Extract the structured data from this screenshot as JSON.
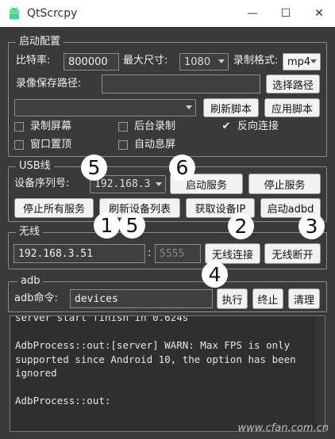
{
  "window": {
    "title": "QtScrcpy",
    "minimize": "—",
    "maximize": "☐",
    "close": "✕"
  },
  "startup": {
    "title": "启动配置",
    "bitrate_label": "比特率:",
    "bitrate_value": "800000",
    "maxsize_label": "最大尺寸:",
    "maxsize_value": "1080",
    "format_label": "录制格式:",
    "format_value": "mp4",
    "savepath_label": "录像保存路径:",
    "savepath_value": "",
    "select_path_button": "选择路径",
    "script_value": "",
    "refresh_script_button": "刷新脚本",
    "apply_script_button": "应用脚本",
    "record_screen": "录制屏幕",
    "background_record": "后台录制",
    "reverse_connect": "反向连接",
    "window_top": "窗口置顶",
    "auto_lock": "自动息屏",
    "check_mark": "✔"
  },
  "usb": {
    "title": "USB线",
    "serial_label": "设备序列号:",
    "serial_value": "192.168.3",
    "start_service_button": "启动服务",
    "stop_service_button": "停止服务",
    "stop_all_button": "停止所有服务",
    "refresh_devices_button": "刷新设备列表",
    "get_ip_button": "获取设备IP",
    "start_adbd_button": "启动adbd"
  },
  "wireless": {
    "title": "无线",
    "ip_value": "192.168.3.51",
    "colon": ":",
    "port_placeholder": "5555",
    "connect_button": "无线连接",
    "disconnect_button": "无线断开"
  },
  "adb": {
    "title": "adb",
    "command_label": "adb命令:",
    "command_value": "devices",
    "execute_button": "执行",
    "terminate_button": "终止",
    "clear_button": "清理"
  },
  "log": {
    "text": "server start finish in 0.624s\n\nAdbProcess::out:[server] WARN: Max FPS is only supported since Android 10, the option has been ignored\n\nAdbProcess::out:"
  },
  "annotations": [
    "5",
    "6",
    "1",
    "5",
    "2",
    "3",
    "4"
  ],
  "watermark": "www.cfan.com.cn"
}
